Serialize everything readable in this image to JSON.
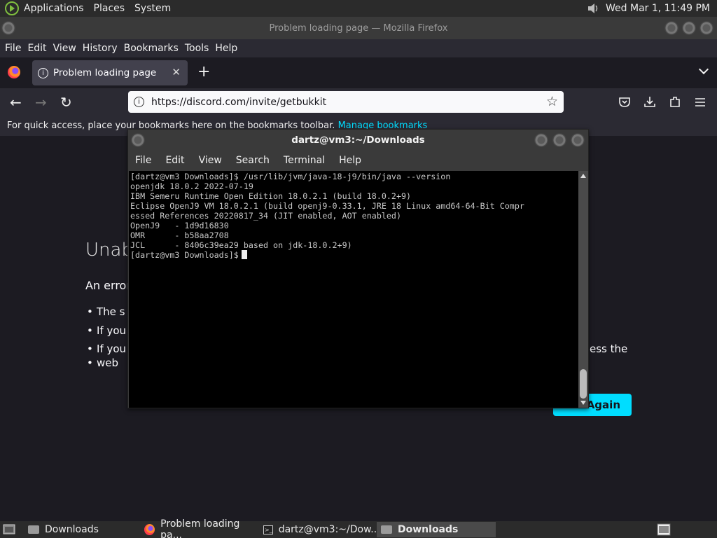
{
  "top_panel": {
    "menus": [
      "Applications",
      "Places",
      "System"
    ],
    "clock": "Wed Mar  1, 11:49 PM"
  },
  "firefox": {
    "window_title": "Problem loading page — Mozilla Firefox",
    "menu": [
      "File",
      "Edit",
      "View",
      "History",
      "Bookmarks",
      "Tools",
      "Help"
    ],
    "tab_title": "Problem loading page",
    "url": "https://discord.com/invite/getbukkit",
    "bookmarks_hint": "For quick access, place your bookmarks here on the bookmarks toolbar.",
    "manage_bookmarks": "Manage bookmarks",
    "error_title_fragment": "Unab",
    "error_text_fragment": "An error",
    "bullets": [
      "The s",
      "If you",
      "If you",
      "web"
    ],
    "right_fragment": "ess the",
    "try_again": "Again"
  },
  "terminal": {
    "title": "dartz@vm3:~/Downloads",
    "menu": [
      "File",
      "Edit",
      "View",
      "Search",
      "Terminal",
      "Help"
    ],
    "lines": [
      "[dartz@vm3 Downloads]$ /usr/lib/jvm/java-18-j9/bin/java --version",
      "openjdk 18.0.2 2022-07-19",
      "IBM Semeru Runtime Open Edition 18.0.2.1 (build 18.0.2+9)",
      "Eclipse OpenJ9 VM 18.0.2.1 (build openj9-0.33.1, JRE 18 Linux amd64-64-Bit Compr",
      "essed References 20220817_34 (JIT enabled, AOT enabled)",
      "OpenJ9   - 1d9d16830",
      "OMR      - b58aa2708",
      "JCL      - 8406c39ea29 based on jdk-18.0.2+9)"
    ],
    "prompt": "[dartz@vm3 Downloads]$"
  },
  "taskbar": {
    "items": [
      "Downloads",
      "Problem loading pa...",
      "dartz@vm3:~/Dow...",
      "Downloads"
    ]
  }
}
